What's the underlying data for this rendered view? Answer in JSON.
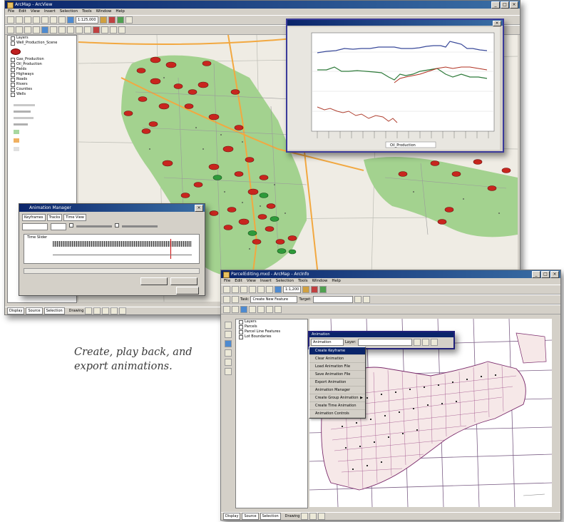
{
  "caption": {
    "text": "Create, play back, and export animations."
  },
  "win1": {
    "title": "ArcMap - ArcView",
    "menus": [
      "File",
      "Edit",
      "View",
      "Insert",
      "Selection",
      "Tools",
      "Window",
      "Help"
    ],
    "scale": "1:125,000",
    "layers_title": "Layers",
    "toc_items": [
      "Well_Production_Scene",
      "Gas_Production",
      "Oil_Production",
      "Fields",
      "Highways",
      "Roads",
      "Rivers",
      "Counties",
      "Wells"
    ],
    "tabs": [
      "Display",
      "Source",
      "Selection"
    ],
    "drawing_label": "Drawing"
  },
  "chart": {
    "legend": "Oil_Production"
  },
  "anim_dialog": {
    "title": "Animation Manager",
    "tabs": [
      "Keyframes",
      "Tracks",
      "Time View"
    ],
    "track_label": "Time Slider"
  },
  "win2": {
    "title": "ParcelEditing.mxd - ArcMap - ArcInfo",
    "menus": [
      "File",
      "Edit",
      "View",
      "Insert",
      "Selection",
      "Tools",
      "Window",
      "Help"
    ],
    "scale": "1:1,200",
    "target_label": "Target:",
    "task_label": "Task:",
    "task_value": "Create New Feature",
    "layers_title": "Layers",
    "toc_items": [
      "Parcels",
      "Parcel Line Features",
      "Lot Boundaries"
    ],
    "tabs": [
      "Display",
      "Source",
      "Selection"
    ],
    "drawing_label": "Drawing"
  },
  "anim_toolbar": {
    "title": "Animation",
    "menu_label": "Animation",
    "layer_label": "Layer:"
  },
  "anim_menu": {
    "items": [
      {
        "label": "Create Keyframe",
        "submenu": false
      },
      {
        "label": "Clear Animation",
        "submenu": false
      },
      {
        "label": "Load Animation File",
        "submenu": false
      },
      {
        "label": "Save Animation File",
        "submenu": false
      },
      {
        "label": "Export Animation",
        "submenu": false
      },
      {
        "label": "Animation Manager",
        "submenu": false
      },
      {
        "label": "Create Group Animation",
        "submenu": true
      },
      {
        "label": "Create Time Animation",
        "submenu": false
      },
      {
        "label": "Animation Controls",
        "submenu": false
      }
    ]
  }
}
